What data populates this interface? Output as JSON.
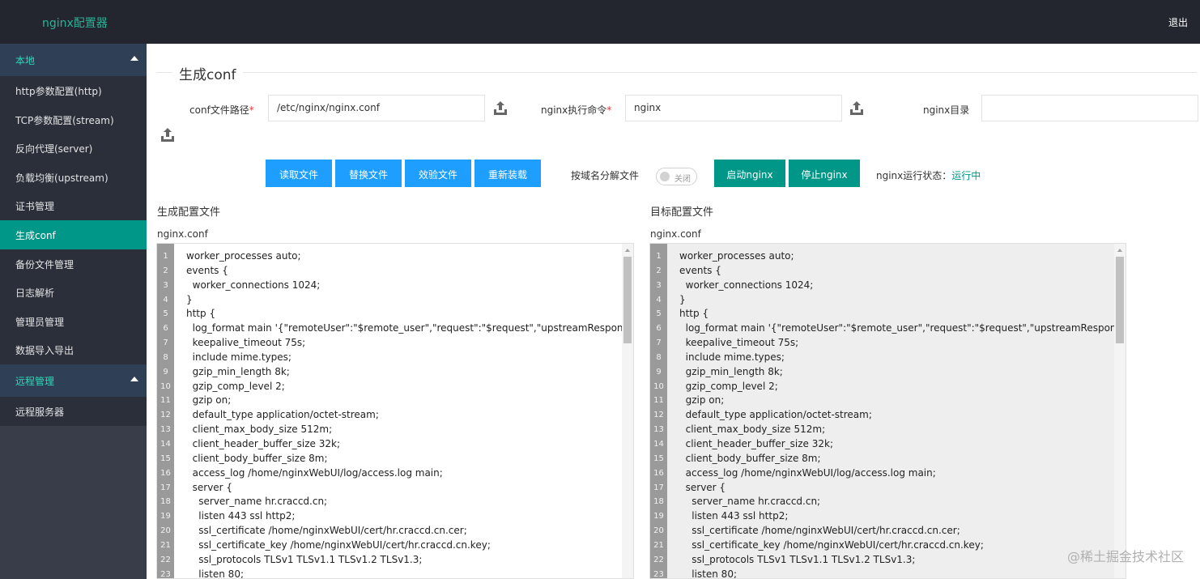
{
  "header": {
    "brand": "nginx配置器",
    "logout": "退出"
  },
  "sidebar": {
    "groups": [
      {
        "label": "本地"
      },
      {
        "label": "远程管理"
      }
    ],
    "local_items": [
      {
        "label": "http参数配置(http)"
      },
      {
        "label": "TCP参数配置(stream)"
      },
      {
        "label": "反向代理(server)"
      },
      {
        "label": "负载均衡(upstream)"
      },
      {
        "label": "证书管理"
      },
      {
        "label": "生成conf"
      },
      {
        "label": "备份文件管理"
      },
      {
        "label": "日志解析"
      },
      {
        "label": "管理员管理"
      },
      {
        "label": "数据导入导出"
      }
    ],
    "remote_items": [
      {
        "label": "远程服务器"
      }
    ]
  },
  "main": {
    "title": "生成conf",
    "conf_path_label": "conf文件路径",
    "conf_path_value": "/etc/nginx/nginx.conf",
    "cmd_label": "nginx执行命令",
    "cmd_value": "nginx",
    "dir_label": "nginx目录",
    "dir_value": "",
    "required_mark": "*",
    "buttons": {
      "read": "读取文件",
      "replace": "替换文件",
      "validate": "效验文件",
      "reload": "重新装载",
      "start": "启动nginx",
      "stop": "停止nginx"
    },
    "split_label": "按域名分解文件",
    "toggle_text": "关闭",
    "status_label": "nginx运行状态：",
    "status_value": "运行中",
    "left_panel_title": "生成配置文件",
    "right_panel_title": "目标配置文件",
    "left_file_name": "nginx.conf",
    "right_file_name": "nginx.conf"
  },
  "code_lines": [
    {
      "n": "1",
      "t": "worker_processes auto;"
    },
    {
      "n": "2",
      "t": "events {"
    },
    {
      "n": "3",
      "t": "  worker_connections 1024;"
    },
    {
      "n": "4",
      "t": "}"
    },
    {
      "n": "5",
      "t": "http {"
    },
    {
      "n": "6",
      "t": "  log_format main '{\"remoteUser\":\"$remote_user\",\"request\":\"$request\",\"upstreamResponseTime'"
    },
    {
      "n": "7",
      "t": "  keepalive_timeout 75s;"
    },
    {
      "n": "8",
      "t": "  include mime.types;"
    },
    {
      "n": "9",
      "t": "  gzip_min_length 8k;"
    },
    {
      "n": "10",
      "t": "  gzip_comp_level 2;"
    },
    {
      "n": "11",
      "t": "  gzip on;"
    },
    {
      "n": "12",
      "t": "  default_type application/octet-stream;"
    },
    {
      "n": "13",
      "t": "  client_max_body_size 512m;"
    },
    {
      "n": "14",
      "t": "  client_header_buffer_size 32k;"
    },
    {
      "n": "15",
      "t": "  client_body_buffer_size 8m;"
    },
    {
      "n": "16",
      "t": "  access_log /home/nginxWebUI/log/access.log main;"
    },
    {
      "n": "17",
      "t": "  server {"
    },
    {
      "n": "18",
      "t": "    server_name hr.craccd.cn;"
    },
    {
      "n": "19",
      "t": "    listen 443 ssl http2;"
    },
    {
      "n": "20",
      "t": "    ssl_certificate /home/nginxWebUI/cert/hr.craccd.cn.cer;"
    },
    {
      "n": "21",
      "t": "    ssl_certificate_key /home/nginxWebUI/cert/hr.craccd.cn.key;"
    },
    {
      "n": "22",
      "t": "    ssl_protocols TLSv1 TLSv1.1 TLSv1.2 TLSv1.3;"
    },
    {
      "n": "23",
      "t": "    listen 80;"
    }
  ],
  "watermark": "@稀土掘金技术社区",
  "colors": {
    "topbar": "#23262e",
    "sidebar": "#393d49",
    "active": "#009688",
    "blue_button": "#1e9fff",
    "brand": "#2bb39a"
  }
}
